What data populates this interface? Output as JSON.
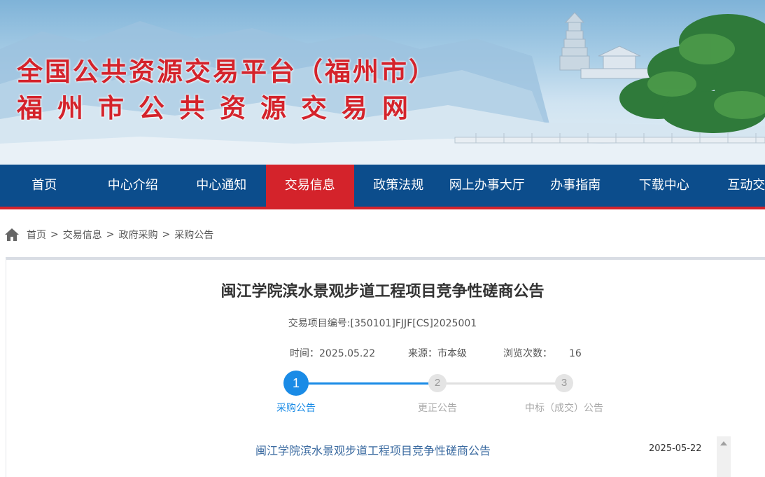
{
  "header": {
    "title_line1": "全国公共资源交易平台（福州市）",
    "title_line2": "福州市公共资源交易网"
  },
  "nav": {
    "items": [
      "首页",
      "中心介绍",
      "中心通知",
      "交易信息",
      "政策法规",
      "网上办事大厅",
      "办事指南",
      "下载中心",
      "互动交流"
    ],
    "active": "交易信息"
  },
  "breadcrumb": {
    "items": [
      "首页",
      "交易信息",
      "政府采购",
      "采购公告"
    ],
    "separator": ">"
  },
  "article": {
    "title": "闽江学院滨水景观步道工程项目竞争性磋商公告",
    "project_code": "交易项目编号:[350101]FJJF[CS]2025001",
    "time_label": "时间：",
    "time_value": "2025.05.22",
    "source_label": "来源：",
    "source_value": "市本级",
    "views_label": "浏览次数：",
    "views_value": "16"
  },
  "steps": {
    "items": [
      {
        "number": "1",
        "label": "采购公告",
        "active": true
      },
      {
        "number": "2",
        "label": "更正公告",
        "active": false
      },
      {
        "number": "3",
        "label": "中标（成交）公告",
        "active": false
      }
    ]
  },
  "list": {
    "items": [
      {
        "title": "闽江学院滨水景观步道工程项目竞争性磋商公告",
        "date": "2025-05-22"
      }
    ]
  },
  "colors": {
    "brand_red": "#d4232b",
    "nav_blue": "#0c4d8c",
    "step_blue": "#1a8be6",
    "link_blue": "#3a6aa0"
  }
}
